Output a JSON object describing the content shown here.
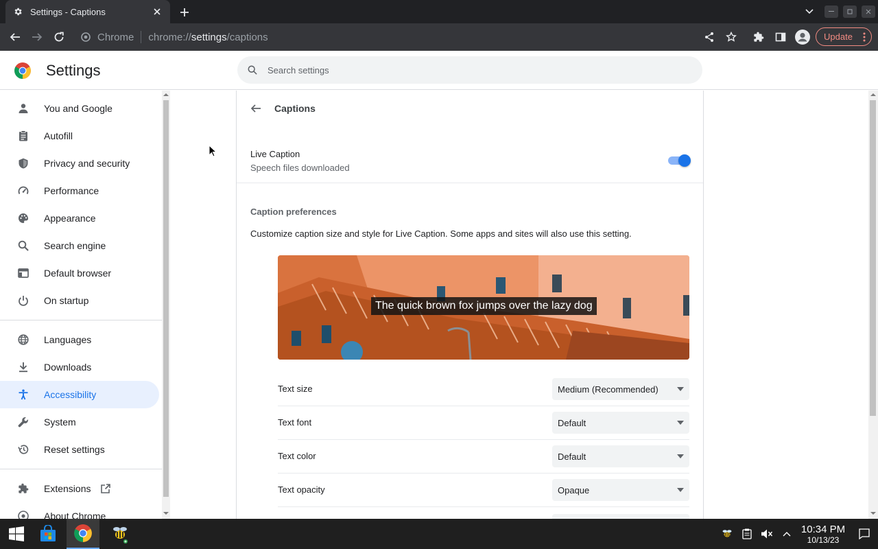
{
  "tab": {
    "title": "Settings - Captions"
  },
  "omnibox": {
    "chip": "Chrome",
    "url_scheme": "chrome://",
    "url_host": "settings",
    "url_path": "/captions"
  },
  "toolbar": {
    "update_label": "Update"
  },
  "header": {
    "title": "Settings",
    "search_placeholder": "Search settings"
  },
  "sidebar": {
    "items": [
      {
        "label": "You and Google",
        "icon": "person-icon"
      },
      {
        "label": "Autofill",
        "icon": "clipboard-icon"
      },
      {
        "label": "Privacy and security",
        "icon": "shield-icon"
      },
      {
        "label": "Performance",
        "icon": "speedometer-icon"
      },
      {
        "label": "Appearance",
        "icon": "palette-icon"
      },
      {
        "label": "Search engine",
        "icon": "search-icon"
      },
      {
        "label": "Default browser",
        "icon": "browser-window-icon"
      },
      {
        "label": "On startup",
        "icon": "power-icon"
      },
      {
        "label": "Languages",
        "icon": "globe-icon"
      },
      {
        "label": "Downloads",
        "icon": "download-icon"
      },
      {
        "label": "Accessibility",
        "icon": "accessibility-icon",
        "active": true
      },
      {
        "label": "System",
        "icon": "wrench-icon"
      },
      {
        "label": "Reset settings",
        "icon": "restore-icon"
      },
      {
        "label": "Extensions",
        "icon": "puzzle-icon"
      },
      {
        "label": "About Chrome",
        "icon": "chrome-icon"
      }
    ]
  },
  "captions": {
    "page_title": "Captions",
    "live_caption": {
      "title": "Live Caption",
      "subtitle": "Speech files downloaded",
      "enabled": true
    },
    "preferences_heading": "Caption preferences",
    "preferences_desc": "Customize caption size and style for Live Caption. Some apps and sites will also use this setting.",
    "preview_text": "The quick brown fox jumps over the lazy dog",
    "rows": [
      {
        "label": "Text size",
        "value": "Medium (Recommended)"
      },
      {
        "label": "Text font",
        "value": "Default"
      },
      {
        "label": "Text color",
        "value": "Default"
      },
      {
        "label": "Text opacity",
        "value": "Opaque"
      }
    ]
  },
  "taskbar": {
    "time": "10:34 PM",
    "date": "10/13/23"
  },
  "colors": {
    "accent": "#1a73e8",
    "active_nav_bg": "#e8f0fe",
    "update_red": "#f28b82",
    "taskbar": "#1f1f1f"
  }
}
